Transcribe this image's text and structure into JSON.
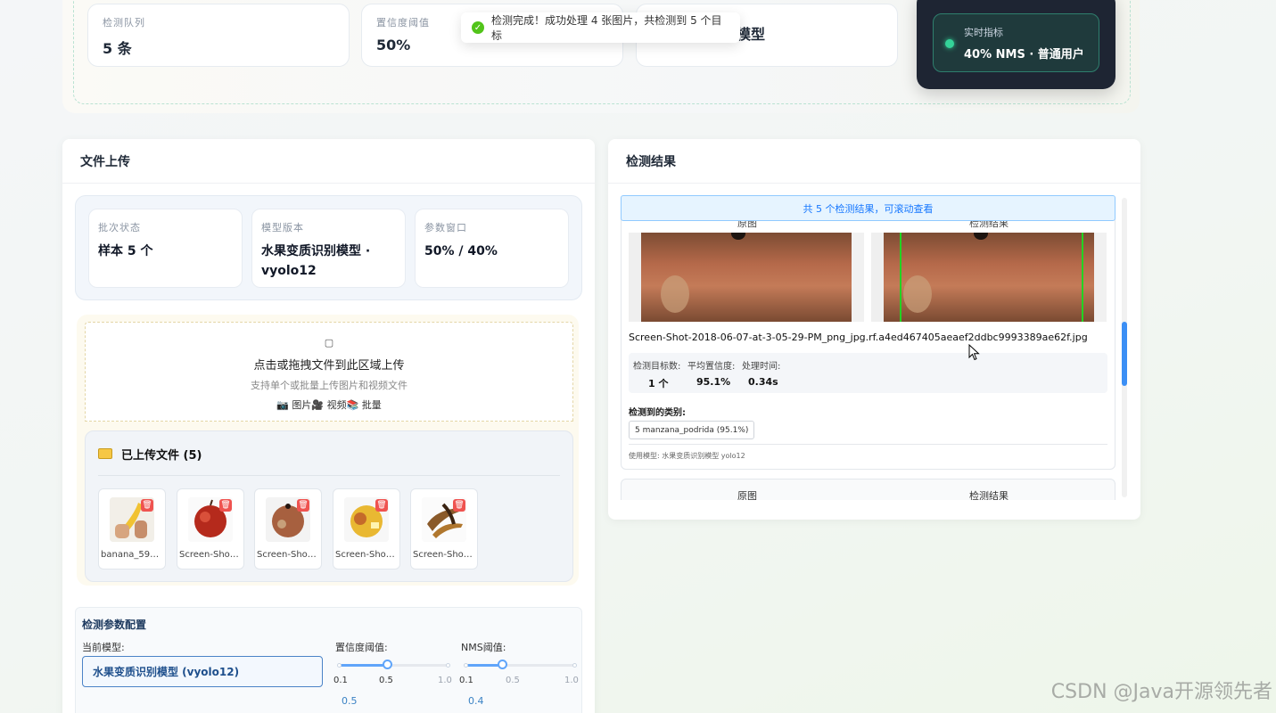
{
  "top": {
    "cards": [
      {
        "label": "检测队列",
        "value": "5 条"
      },
      {
        "label": "置信度阈值",
        "value": "50%"
      },
      {
        "label": "",
        "value": "水果变质识别模型"
      }
    ],
    "metric": {
      "label": "实时指标",
      "value": "40% NMS · 普通用户"
    },
    "toast": "检测完成！成功处理 4 张图片，共检测到 5 个目标"
  },
  "upload_panel": {
    "title": "文件上传",
    "batch": [
      {
        "label": "批次状态",
        "value": "样本 5 个"
      },
      {
        "label": "模型版本",
        "value": "水果变质识别模型 · vyolo12"
      },
      {
        "label": "参数窗口",
        "value": "50% / 40%"
      }
    ],
    "dropzone": {
      "title": "点击或拖拽文件到此区域上传",
      "subtitle": "支持单个或批量上传图片和视频文件",
      "types": "📷 图片🎥 视频📚 批量"
    },
    "files": {
      "title": "已上传文件 (5)",
      "items": [
        {
          "name": "banana_59_j...",
          "icon": "banana-thumbnail"
        },
        {
          "name": "Screen-Shot-...",
          "icon": "red-apple-thumbnail"
        },
        {
          "name": "Screen-Shot-...",
          "icon": "rotten-apple-thumbnail"
        },
        {
          "name": "Screen-Shot-...",
          "icon": "yellow-apple-thumbnail"
        },
        {
          "name": "Screen-Shot-...",
          "icon": "rotten-banana-thumbnail"
        }
      ]
    },
    "params": {
      "title": "检测参数配置",
      "model_label": "当前模型:",
      "model_value": "水果变质识别模型 (vyolo12)",
      "conf": {
        "label": "置信度阈值:",
        "min": "0.1",
        "mid": "0.5",
        "max": "1.0",
        "value": 0.5,
        "display": "0.5"
      },
      "nms": {
        "label": "NMS阈值:",
        "min": "0.1",
        "mid": "0.5",
        "max": "1.0",
        "value": 0.4,
        "display": "0.4"
      }
    }
  },
  "results_panel": {
    "title": "检测结果",
    "info": "共 5 个检测结果，可滚动查看",
    "card": {
      "orig_caption": "原图",
      "det_caption": "检测结果",
      "filename": "Screen-Shot-2018-06-07-at-3-05-29-PM_png_jpg.rf.a4ed467405aeaef2ddbc9993389ae62f.jpg",
      "stats": [
        {
          "label": "检测目标数:",
          "value": "1 个"
        },
        {
          "label": "平均置信度:",
          "value": "95.1%"
        },
        {
          "label": "处理时间:",
          "value": "0.34s"
        }
      ],
      "classes_title": "检测到的类别:",
      "class_tag": "5 manzana_podrida (95.1%)",
      "model_used": "使用模型: 水果变质识别模型 yolo12"
    },
    "card2": {
      "orig_caption": "原图",
      "det_caption": "检测结果"
    }
  },
  "watermark": "CSDN @Java开源领先者"
}
